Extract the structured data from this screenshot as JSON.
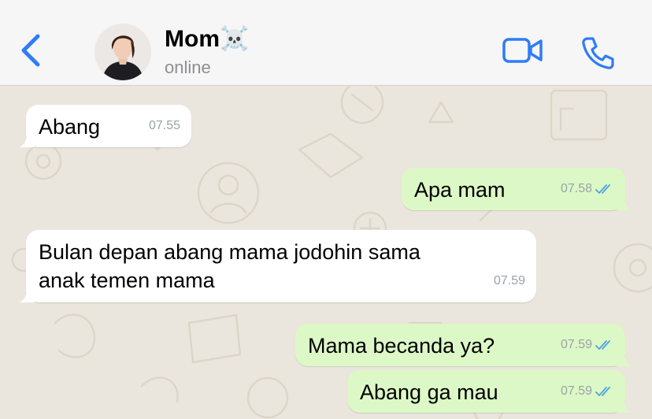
{
  "header": {
    "contact_name": "Mom",
    "contact_emoji": "☠️",
    "status": "online"
  },
  "messages": [
    {
      "direction": "incoming",
      "text": "Abang",
      "time": "07.55"
    },
    {
      "direction": "outgoing",
      "text": "Apa mam",
      "time": "07.58",
      "read": true
    },
    {
      "direction": "incoming",
      "text": "Bulan depan abang mama jodohin sama anak temen mama",
      "time": "07.59"
    },
    {
      "direction": "outgoing",
      "text": "Mama becanda ya?",
      "time": "07.59",
      "read": true
    },
    {
      "direction": "outgoing",
      "text": "Abang ga mau",
      "time": "07.59",
      "read": true
    }
  ],
  "colors": {
    "accent": "#2f7cf6",
    "incoming_bubble": "#ffffff",
    "outgoing_bubble": "#dcf8c6",
    "read_tick": "#4fa3e0",
    "wallpaper": "#ebe6dd"
  }
}
